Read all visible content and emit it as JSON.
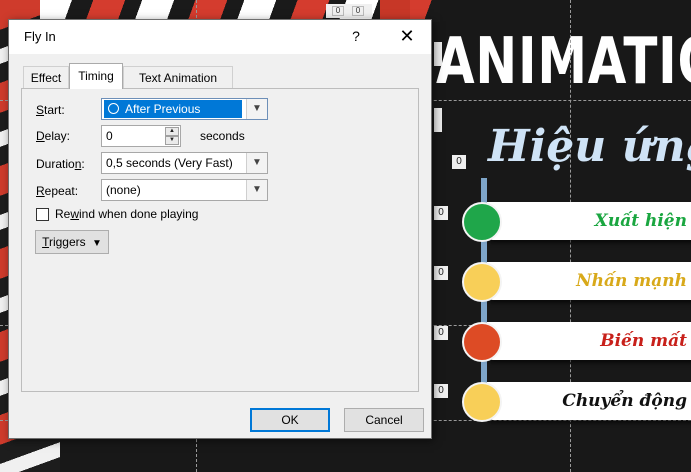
{
  "slide": {
    "title": "ANIMATIO",
    "subtitle": "Hiệu ứng",
    "top_counter": [
      "0",
      "0"
    ],
    "tags": [
      "0",
      "0",
      "0",
      "0",
      "0"
    ],
    "items": [
      {
        "label": "Xuất hiện",
        "color": "#1fa64a",
        "text_color": "#1aa640"
      },
      {
        "label": "Nhấn mạnh",
        "color": "#f8cf58",
        "text_color": "#d8a91a"
      },
      {
        "label": "Biến mất",
        "color": "#dd4b25",
        "text_color": "#c8201a"
      },
      {
        "label": "Chuyển động",
        "color": "#f8cf58",
        "text_color": "#111111"
      }
    ]
  },
  "dialog": {
    "title": "Fly In",
    "help_label": "?",
    "close_label": "✕",
    "tabs": [
      {
        "label": "Effect",
        "active": false
      },
      {
        "label": "Timing",
        "active": true
      },
      {
        "label": "Text Animation",
        "active": false
      }
    ],
    "start": {
      "label_underlined": "S",
      "label_rest": "tart:",
      "value": "After Previous"
    },
    "delay": {
      "label_underlined": "D",
      "label_rest": "elay:",
      "value": "0",
      "unit": "seconds"
    },
    "duration": {
      "label_before": "Duratio",
      "label_underlined": "n",
      "label_rest": ":",
      "value": "0,5 seconds (Very Fast)"
    },
    "repeat": {
      "label_underlined": "R",
      "label_rest": "epeat:",
      "value": "(none)"
    },
    "rewind": {
      "label_before": "Re",
      "label_underlined": "w",
      "label_rest": "ind when done playing",
      "checked": false
    },
    "triggers": {
      "label_underlined": "T",
      "label_rest": "riggers",
      "icon": "double-chevron-down-icon"
    },
    "ok_label": "OK",
    "cancel_label": "Cancel",
    "accent": "#0078d7"
  }
}
